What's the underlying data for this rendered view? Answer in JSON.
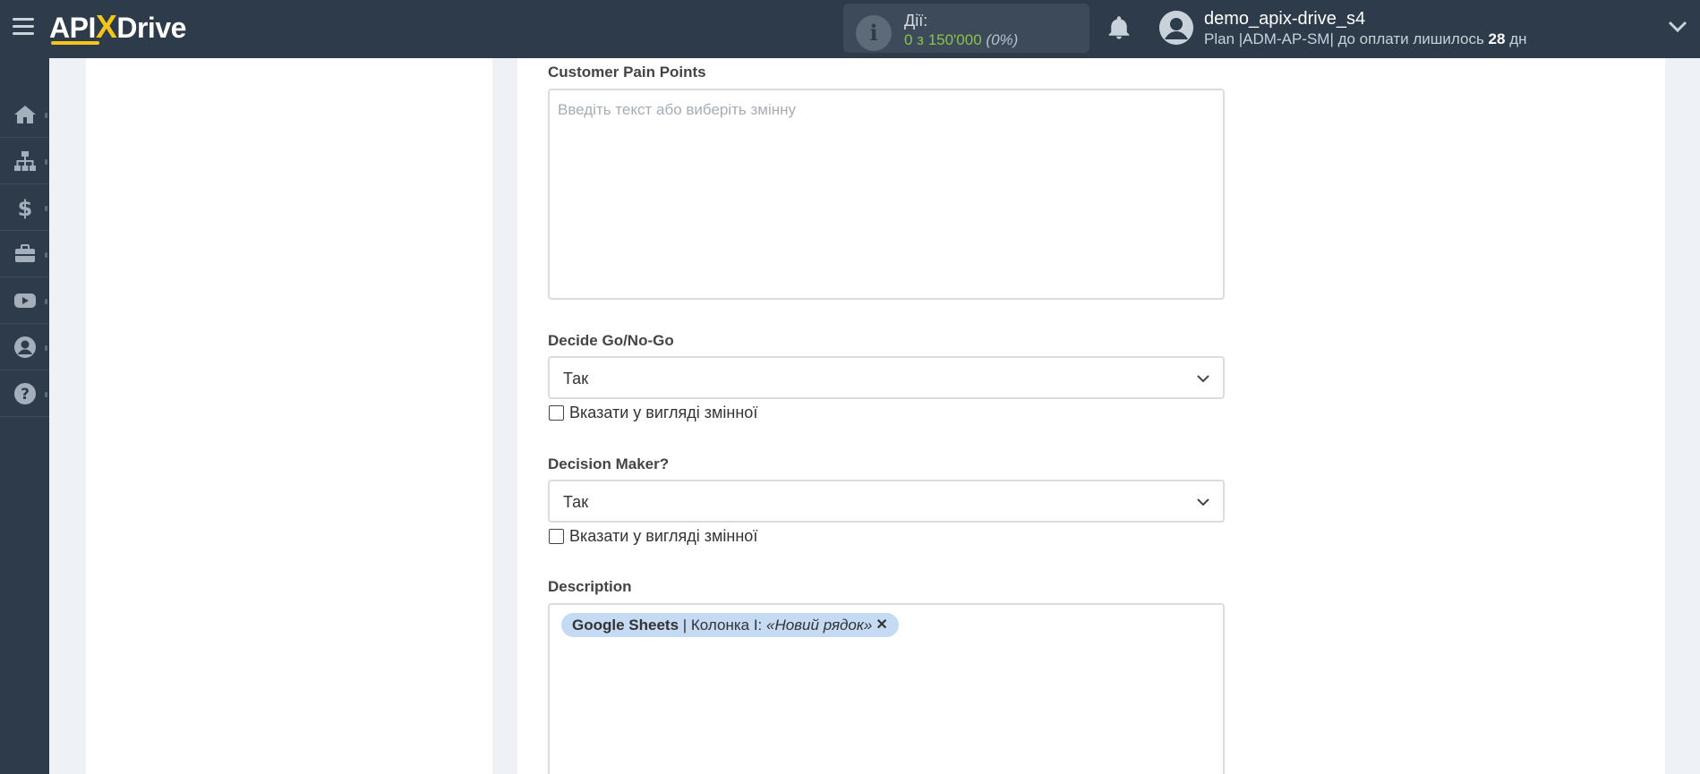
{
  "header": {
    "logo_main": "API",
    "logo_x": "X",
    "logo_end": "Drive",
    "actions_label": "Дії:",
    "actions_value": "0 з 150'000",
    "actions_percent": "(0%)",
    "user_name": "demo_apix-drive_s4",
    "plan_prefix": "Plan |ADM-AP-SM| до оплати лишилось ",
    "plan_days": "28",
    "plan_suffix": " дн"
  },
  "sidebar": {
    "items": [
      {
        "icon": "home-icon"
      },
      {
        "icon": "sitemap-icon"
      },
      {
        "icon": "dollar-icon"
      },
      {
        "icon": "briefcase-icon"
      },
      {
        "icon": "youtube-icon"
      },
      {
        "icon": "user-circle-icon"
      },
      {
        "icon": "question-circle-icon"
      }
    ]
  },
  "form": {
    "pain_points": {
      "label": "Customer Pain Points",
      "placeholder": "Введіть текст або виберіть змінну"
    },
    "go_nogo": {
      "label": "Decide Go/No-Go",
      "value": "Так",
      "checkbox_label": "Вказати у вигляді змінної"
    },
    "decision_maker": {
      "label": "Decision Maker?",
      "value": "Так",
      "checkbox_label": "Вказати у вигляді змінної"
    },
    "description": {
      "label": "Description",
      "tag_source": "Google Sheets",
      "tag_column": " | Колонка I: ",
      "tag_value": "«Новий рядок»",
      "tag_remove": "✕"
    }
  },
  "colors": {
    "topbar": "#2d3b4a",
    "accent_yellow": "#f5c518",
    "actions_green": "#8bc34a",
    "tag_bg": "#c5daf3"
  }
}
